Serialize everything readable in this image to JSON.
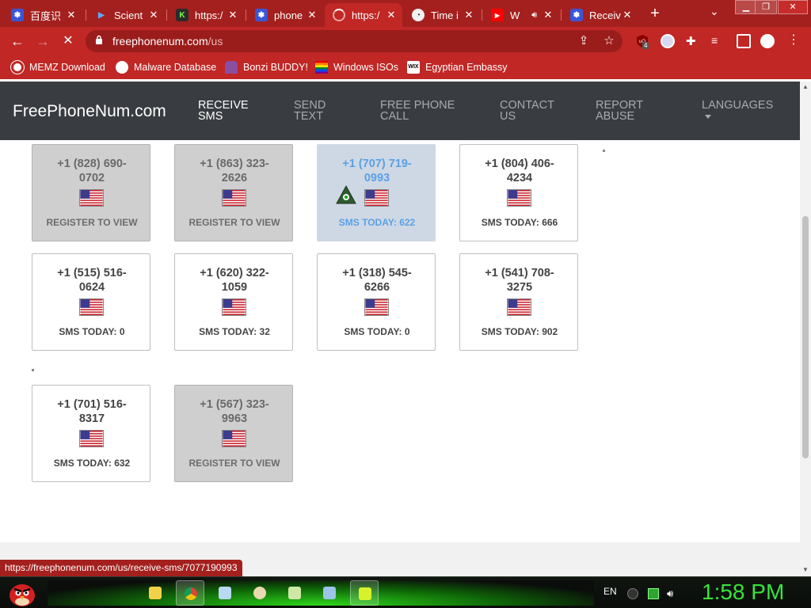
{
  "tabs": [
    {
      "title": "百度识",
      "icon": "baidu-paw-icon"
    },
    {
      "title": "Scient",
      "icon": "scientific-logo-icon"
    },
    {
      "title": "https:/",
      "icon": "kiwi-icon"
    },
    {
      "title": "phone",
      "icon": "baidu-paw-icon"
    },
    {
      "title": "https:/",
      "icon": "loading-spinner-icon"
    },
    {
      "title": "Time i",
      "icon": "clock-icon"
    },
    {
      "title": "W",
      "icon": "youtube-icon"
    },
    {
      "title": "Receiv",
      "icon": "baidu-paw-icon"
    }
  ],
  "toolbar": {
    "url_domain": "freephonenum.com",
    "url_path": "/us",
    "extension_badge": "4"
  },
  "bookmarks": [
    {
      "label": "MEMZ Download",
      "icon": "memz-icon"
    },
    {
      "label": "Malware Database",
      "icon": "globe-icon"
    },
    {
      "label": "Bonzi BUDDY!",
      "icon": "bonzi-icon"
    },
    {
      "label": "Windows ISOs",
      "icon": "rainbow-flag-icon"
    },
    {
      "label": "Egyptian Embassy",
      "icon": "wix-icon"
    }
  ],
  "site": {
    "logo": "FreePhoneNum.com",
    "nav": [
      {
        "line1": "RECEIVE",
        "line2": "SMS"
      },
      {
        "line1": "SEND",
        "line2": "TEXT"
      },
      {
        "line1": "FREE PHONE",
        "line2": "CALL"
      },
      {
        "line1": "CONTACT",
        "line2": "US"
      },
      {
        "line1": "REPORT",
        "line2": "ABUSE"
      },
      {
        "line1": "LANGUAGES",
        "line2": ""
      }
    ]
  },
  "cards": [
    {
      "line1": "+1 (828) 690-",
      "line2": "0702",
      "label": "REGISTER TO VIEW"
    },
    {
      "line1": "+1 (863) 323-",
      "line2": "2626",
      "label": "REGISTER TO VIEW"
    },
    {
      "line1": "+1 (707) 719-",
      "line2": "0993",
      "label": "SMS TODAY: 622"
    },
    {
      "line1": "+1 (804) 406-",
      "line2": "4234",
      "label": "SMS TODAY: 666"
    },
    {
      "line1": "+1 (515) 516-",
      "line2": "0624",
      "label": "SMS TODAY: 0"
    },
    {
      "line1": "+1 (620) 322-",
      "line2": "1059",
      "label": "SMS TODAY: 32"
    },
    {
      "line1": "+1 (318) 545-",
      "line2": "6266",
      "label": "SMS TODAY: 0"
    },
    {
      "line1": "+1 (541) 708-",
      "line2": "3275",
      "label": "SMS TODAY: 902"
    },
    {
      "line1": "+1 (701) 516-",
      "line2": "8317",
      "label": "SMS TODAY: 632"
    },
    {
      "line1": "+1 (567) 323-",
      "line2": "9963",
      "label": "REGISTER TO VIEW"
    }
  ],
  "status_url": "https://freephonenum.com/us/receive-sms/7077190993",
  "taskbar": {
    "language": "EN",
    "time": "1:58 PM"
  },
  "colors": {
    "browser_theme": "#c02725",
    "site_header": "#393c41",
    "link_hover": "#5aa0e6",
    "clock": "#39e33c"
  }
}
